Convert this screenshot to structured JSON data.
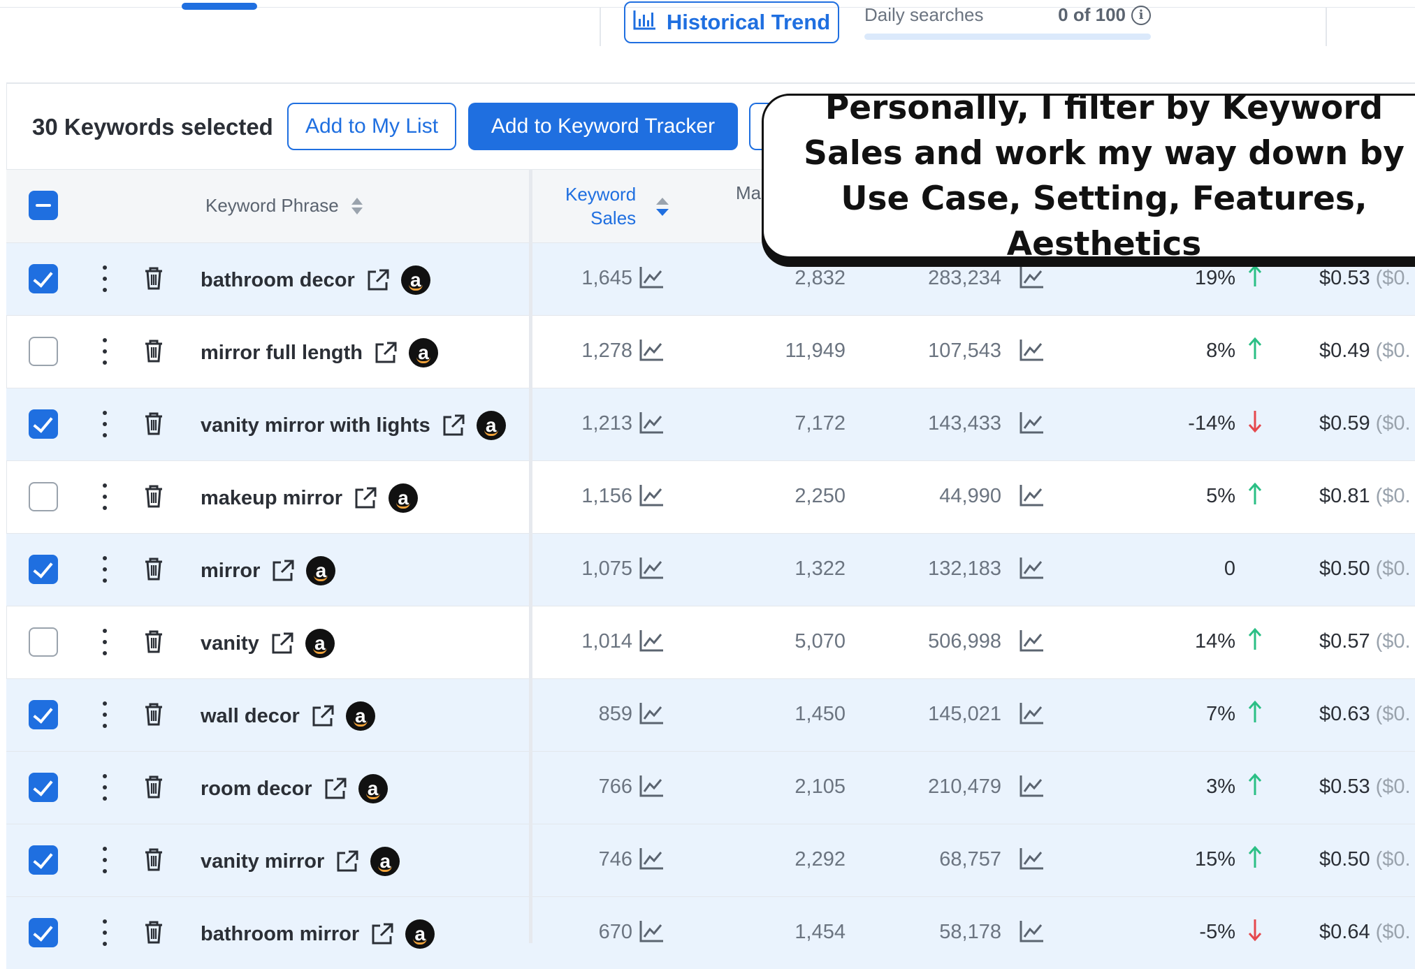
{
  "toolbar": {
    "historical_trend_label": "Historical Trend",
    "daily_searches_label": "Daily searches",
    "daily_searches_count": "0 of 100",
    "info_glyph": "i"
  },
  "actions": {
    "selected_count": "30 Keywords selected",
    "add_to_list": "Add to My List",
    "add_to_tracker": "Add to Keyword Tracker"
  },
  "table": {
    "headers": {
      "keyword_phrase": "Keyword Phrase",
      "keyword_sales_1": "Keyword",
      "keyword_sales_2": "Sales",
      "partial_col": "Ma"
    },
    "rows": [
      {
        "selected": true,
        "phrase": "bathroom decor",
        "sales": "1,645",
        "col3": "2,832",
        "col4": "283,234",
        "pct": "19%",
        "trend": "up",
        "price": "$0.53",
        "price_extra": " ($0."
      },
      {
        "selected": false,
        "phrase": "mirror full length",
        "sales": "1,278",
        "col3": "11,949",
        "col4": "107,543",
        "pct": "8%",
        "trend": "up",
        "price": "$0.49",
        "price_extra": " ($0."
      },
      {
        "selected": true,
        "phrase": "vanity mirror with lights",
        "sales": "1,213",
        "col3": "7,172",
        "col4": "143,433",
        "pct": "-14%",
        "trend": "down",
        "price": "$0.59",
        "price_extra": " ($0."
      },
      {
        "selected": false,
        "phrase": "makeup mirror",
        "sales": "1,156",
        "col3": "2,250",
        "col4": "44,990",
        "pct": "5%",
        "trend": "up",
        "price": "$0.81",
        "price_extra": " ($0."
      },
      {
        "selected": true,
        "phrase": "mirror",
        "sales": "1,075",
        "col3": "1,322",
        "col4": "132,183",
        "pct": "0",
        "trend": "none",
        "price": "$0.50",
        "price_extra": " ($0."
      },
      {
        "selected": false,
        "phrase": "vanity",
        "sales": "1,014",
        "col3": "5,070",
        "col4": "506,998",
        "pct": "14%",
        "trend": "up",
        "price": "$0.57",
        "price_extra": " ($0."
      },
      {
        "selected": true,
        "phrase": "wall decor",
        "sales": "859",
        "col3": "1,450",
        "col4": "145,021",
        "pct": "7%",
        "trend": "up",
        "price": "$0.63",
        "price_extra": " ($0."
      },
      {
        "selected": true,
        "phrase": "room decor",
        "sales": "766",
        "col3": "2,105",
        "col4": "210,479",
        "pct": "3%",
        "trend": "up",
        "price": "$0.53",
        "price_extra": " ($0."
      },
      {
        "selected": true,
        "phrase": "vanity mirror",
        "sales": "746",
        "col3": "2,292",
        "col4": "68,757",
        "pct": "15%",
        "trend": "up",
        "price": "$0.50",
        "price_extra": " ($0."
      },
      {
        "selected": true,
        "phrase": "bathroom mirror",
        "sales": "670",
        "col3": "1,454",
        "col4": "58,178",
        "pct": "-5%",
        "trend": "down",
        "price": "$0.64",
        "price_extra": " ($0."
      }
    ]
  },
  "callout": {
    "text": "Personally, I filter by Keyword Sales and work my way down by Use Case, Setting, Features, Aesthetics"
  },
  "colors": {
    "accent": "#1f6fe0",
    "selected_row": "#eaf3fd",
    "trend_up": "#2bbf85",
    "trend_down": "#e5484d"
  },
  "icons": {
    "historical_trend": "bar-chart-icon",
    "row_menu": "kebab-menu-icon",
    "row_delete": "trash-icon",
    "external_link": "external-link-icon",
    "amazon": "amazon-logo-icon",
    "sparkline": "line-chart-icon",
    "sort": "sort-icon",
    "info": "info-icon"
  }
}
